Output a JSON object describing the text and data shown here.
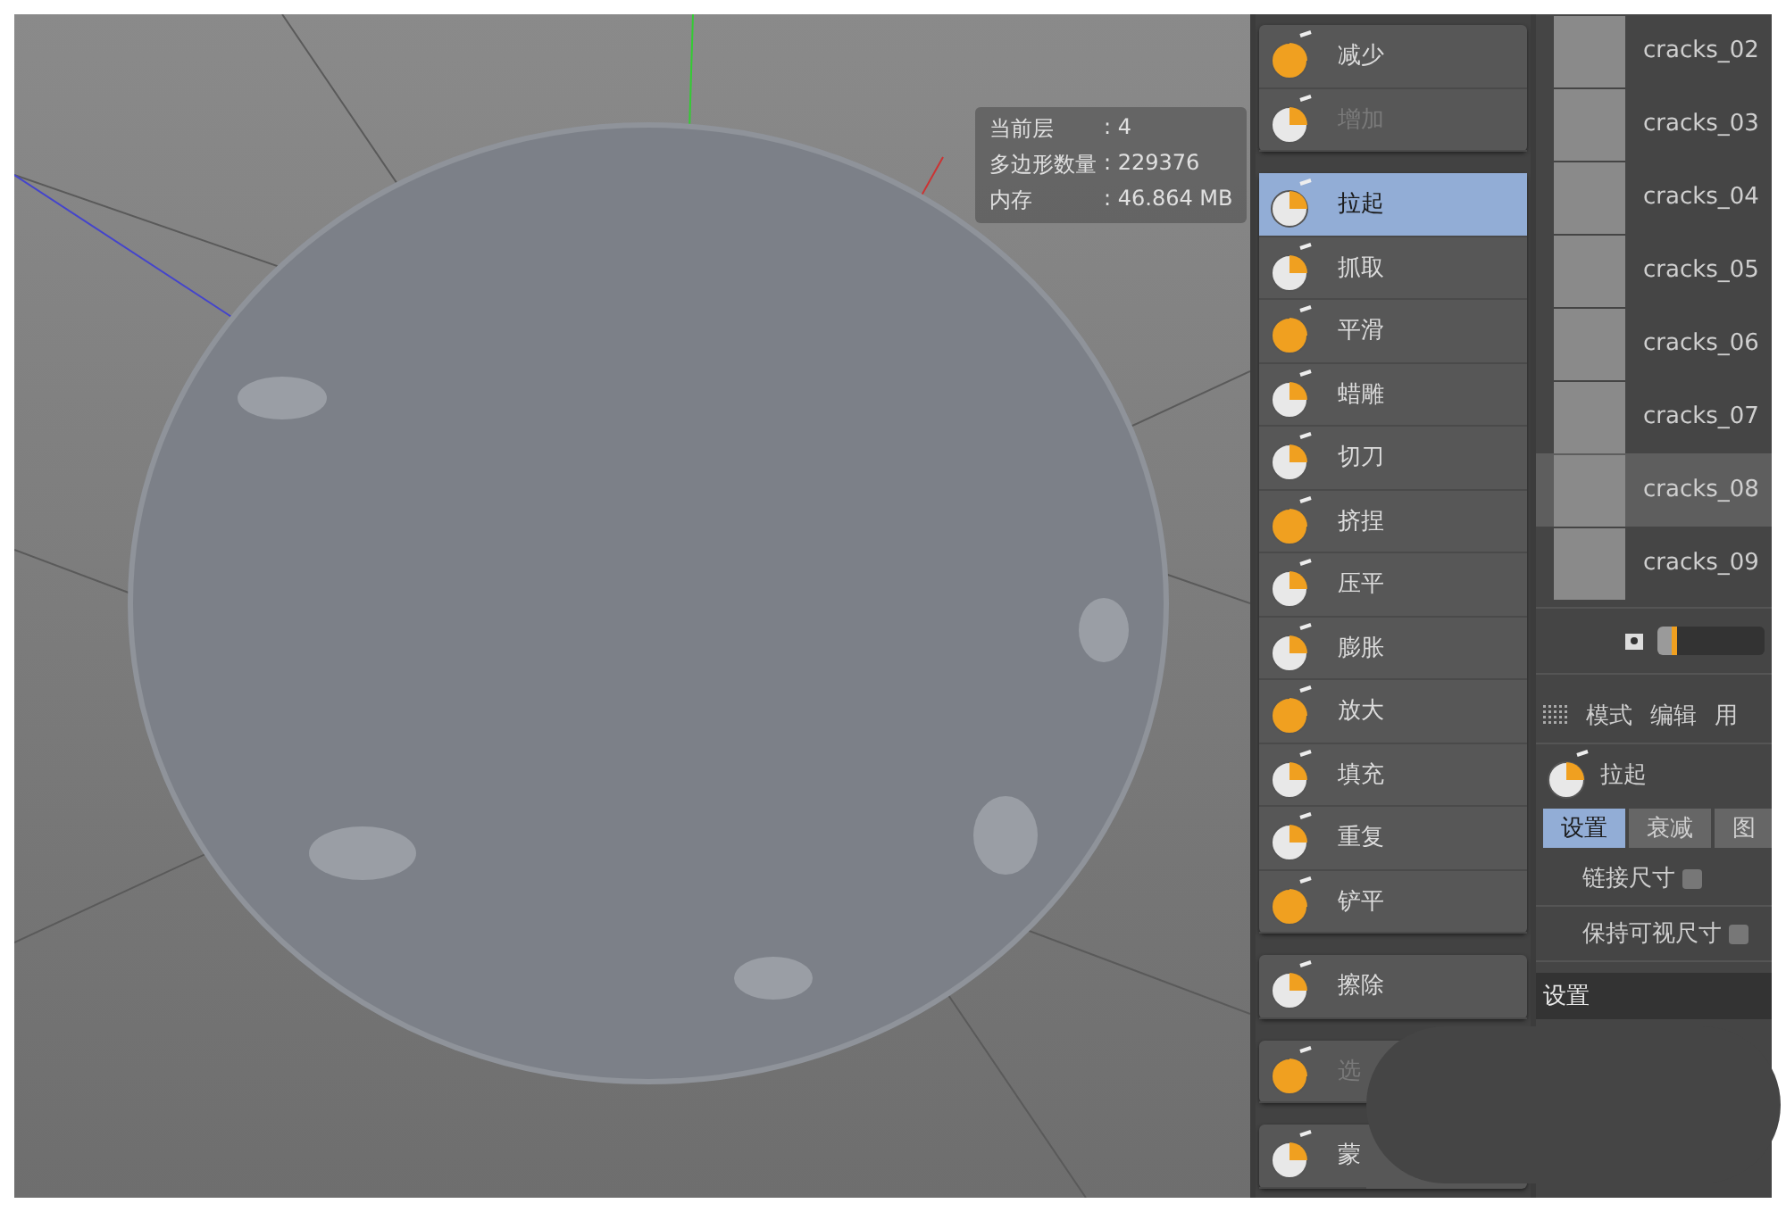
{
  "viewport": {
    "stats": [
      {
        "label": "当前层",
        "value": ": 4"
      },
      {
        "label": "多边形数量",
        "value": ": 229376"
      },
      {
        "label": "内存",
        "value": ": 46.864 MB"
      }
    ]
  },
  "tool_groups": [
    {
      "tools": [
        {
          "label": "减少",
          "selected": false,
          "disabled": false
        },
        {
          "label": "增加",
          "selected": false,
          "disabled": true
        }
      ]
    },
    {
      "tools": [
        {
          "label": "拉起",
          "selected": true,
          "disabled": false
        },
        {
          "label": "抓取",
          "selected": false,
          "disabled": false
        },
        {
          "label": "平滑",
          "selected": false,
          "disabled": false
        },
        {
          "label": "蜡雕",
          "selected": false,
          "disabled": false
        },
        {
          "label": "切刀",
          "selected": false,
          "disabled": false
        },
        {
          "label": "挤捏",
          "selected": false,
          "disabled": false
        },
        {
          "label": "压平",
          "selected": false,
          "disabled": false
        },
        {
          "label": "膨胀",
          "selected": false,
          "disabled": false
        },
        {
          "label": "放大",
          "selected": false,
          "disabled": false
        },
        {
          "label": "填充",
          "selected": false,
          "disabled": false
        },
        {
          "label": "重复",
          "selected": false,
          "disabled": false
        },
        {
          "label": "铲平",
          "selected": false,
          "disabled": false
        }
      ]
    },
    {
      "tools": [
        {
          "label": "擦除",
          "selected": false,
          "disabled": false
        }
      ]
    },
    {
      "tools": [
        {
          "label": "选",
          "selected": false,
          "disabled": true
        }
      ]
    },
    {
      "tools": [
        {
          "label": "蒙",
          "selected": false,
          "disabled": false
        }
      ]
    }
  ],
  "stamps": {
    "items": [
      {
        "label": "cracks_02",
        "selected": false
      },
      {
        "label": "cracks_03",
        "selected": false
      },
      {
        "label": "cracks_04",
        "selected": false
      },
      {
        "label": "cracks_05",
        "selected": false
      },
      {
        "label": "cracks_06",
        "selected": false
      },
      {
        "label": "cracks_07",
        "selected": false
      },
      {
        "label": "cracks_08",
        "selected": true
      },
      {
        "label": "cracks_09",
        "selected": false
      }
    ],
    "size": {
      "level": 0.18
    }
  },
  "attributes": {
    "menu": [
      "模式",
      "编辑",
      "用"
    ],
    "tool_name": "拉起",
    "tabs": [
      {
        "label": "设置",
        "selected": true
      },
      {
        "label": "衰减",
        "selected": false
      },
      {
        "label": "图",
        "selected": false
      }
    ],
    "options": [
      {
        "label": "链接尺寸",
        "checked": false
      },
      {
        "label": "保持可视尺寸",
        "checked": false
      }
    ],
    "section": "设置"
  }
}
